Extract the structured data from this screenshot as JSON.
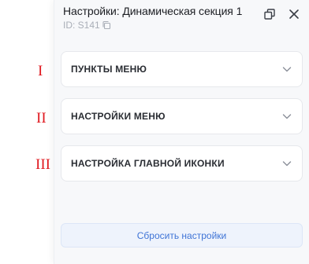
{
  "annotations": [
    "I",
    "II",
    "III"
  ],
  "panel": {
    "title": "Настройки: Динамическая секция 1",
    "id_label": "ID: S141",
    "actions": {
      "popout_icon": "popout-icon",
      "close_icon": "close-icon"
    }
  },
  "sections": [
    {
      "label": "ПУНКТЫ МЕНЮ",
      "expanded": false
    },
    {
      "label": "НАСТРОЙКИ МЕНЮ",
      "expanded": false
    },
    {
      "label": "НАСТРОЙКА ГЛАВНОЙ ИКОНКИ",
      "expanded": false
    }
  ],
  "reset_label": "Сбросить настройки",
  "colors": {
    "accent": "#3f74d6",
    "annotation": "#e0181f",
    "panel_bg": "#f7f8fa"
  }
}
